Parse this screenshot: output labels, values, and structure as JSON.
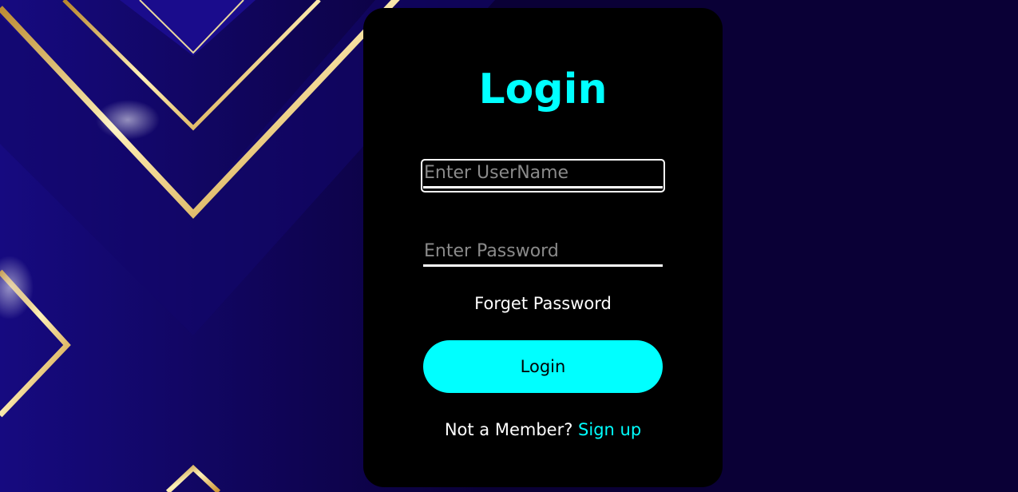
{
  "colors": {
    "background": "#0a0036",
    "card": "#000000",
    "accent": "#00ffff",
    "gold": "#d9a441"
  },
  "login_form": {
    "title": "Login",
    "username_placeholder": "Enter UserName",
    "password_placeholder": "Enter Password",
    "forgot_label": "Forget Password",
    "login_button_label": "Login",
    "signup_prompt": "Not a Member?",
    "signup_link_label": "Sign up"
  }
}
